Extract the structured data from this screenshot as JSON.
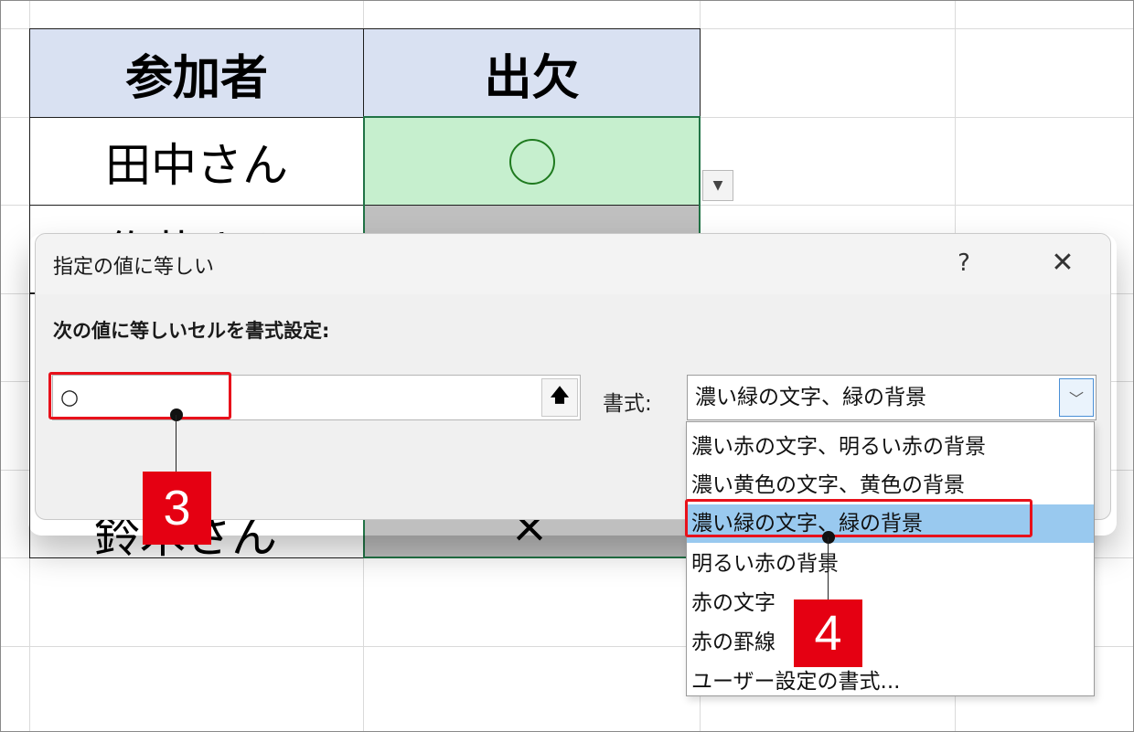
{
  "sheet": {
    "headers": [
      "参加者",
      "出欠"
    ],
    "rows": [
      {
        "name": "田中さん",
        "status": "○"
      },
      {
        "name": "佐藤さん",
        "status": ""
      },
      {
        "name": "鈴木さん",
        "status": "×"
      }
    ],
    "colors": {
      "header_bg": "#d9e1f2",
      "green_fill": "#c6efce",
      "grey_fill": "#bfbfbf"
    }
  },
  "dialog": {
    "title": "指定の値に等しい",
    "help": "?",
    "close": "✕",
    "prompt": "次の値に等しいセルを書式設定:",
    "value": "○",
    "format_label": "書式:",
    "format_selected": "濃い緑の文字、緑の背景",
    "format_options": [
      "濃い赤の文字、明るい赤の背景",
      "濃い黄色の文字、黄色の背景",
      "濃い緑の文字、緑の背景",
      "明るい赤の背景",
      "赤の文字",
      "赤の罫線",
      "ユーザー設定の書式..."
    ]
  },
  "callouts": {
    "step3": "3",
    "step4": "4",
    "color": "#e50012"
  },
  "icons": {
    "collapse": "upload-arrow-icon",
    "chevron": "chevron-down-icon",
    "dropdown": "dropdown-arrow-icon"
  }
}
